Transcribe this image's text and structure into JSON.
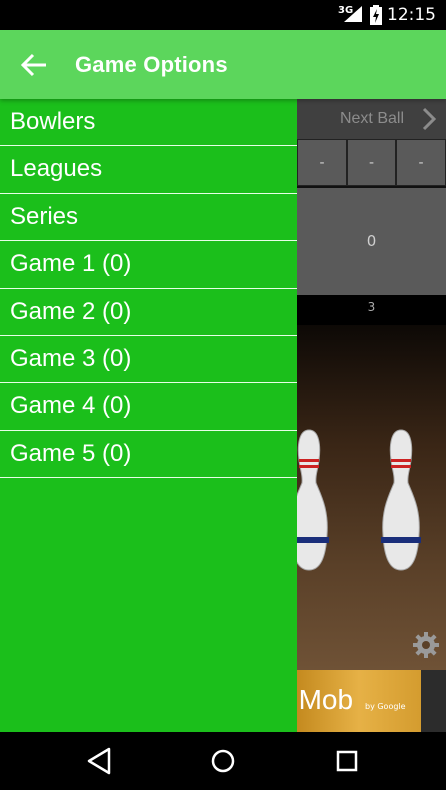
{
  "status_bar": {
    "network": "3G",
    "time": "12:15"
  },
  "app_bar": {
    "back_icon": "arrow-left-icon",
    "title": "Game Options"
  },
  "drawer": {
    "items": [
      {
        "label": "Bowlers"
      },
      {
        "label": "Leagues"
      },
      {
        "label": "Series"
      },
      {
        "label": "Game 1 (0)"
      },
      {
        "label": "Game 2 (0)"
      },
      {
        "label": "Game 3 (0)"
      },
      {
        "label": "Game 4 (0)"
      },
      {
        "label": "Game 5 (0)"
      }
    ]
  },
  "game": {
    "next_ball_label": "Next Ball",
    "frame_cells": [
      "-",
      "-",
      "-"
    ],
    "frame_total": "0",
    "frame_number": "3",
    "settings_icon": "gear-icon",
    "ad_text": "dMob",
    "ad_sub": "by Google"
  },
  "nav_bar": {
    "back_icon": "triangle-back-icon",
    "home_icon": "circle-home-icon",
    "recents_icon": "square-recents-icon"
  },
  "colors": {
    "app_bar": "#5cd65c",
    "drawer": "#1bbf1b",
    "divider": "#e6ffe6"
  }
}
